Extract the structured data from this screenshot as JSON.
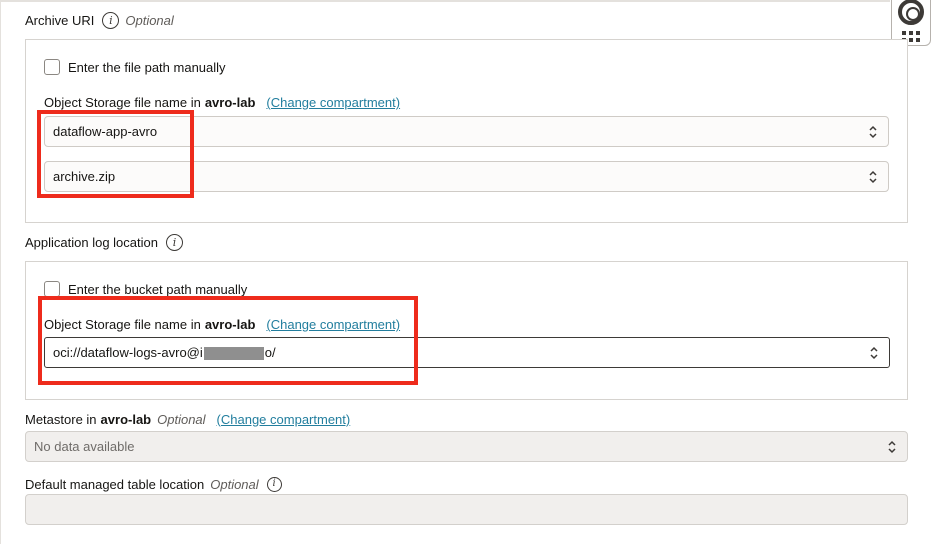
{
  "archive": {
    "label": "Archive URI",
    "optional": "Optional",
    "manual_checkbox": "Enter the file path manually",
    "storage_label_prefix": "Object Storage file name in",
    "compartment": "avro-lab",
    "change_link": "(Change compartment)",
    "bucket_value": "dataflow-app-avro",
    "file_value": "archive.zip"
  },
  "applog": {
    "label": "Application log location",
    "manual_checkbox": "Enter the bucket path manually",
    "storage_label_prefix": "Object Storage file name in",
    "compartment": "avro-lab",
    "change_link": "(Change compartment)",
    "value_prefix": "oci://dataflow-logs-avro@i",
    "value_suffix": "o/"
  },
  "metastore": {
    "label_prefix": "Metastore in",
    "compartment": "avro-lab",
    "optional": "Optional",
    "change_link": "(Change compartment)",
    "value": "No data available"
  },
  "managed_table": {
    "label": "Default managed table location",
    "optional": "Optional",
    "value": ""
  },
  "icons": {
    "info": "i"
  },
  "colors": {
    "highlight": "#ee2b1c",
    "link": "#227e9e"
  }
}
